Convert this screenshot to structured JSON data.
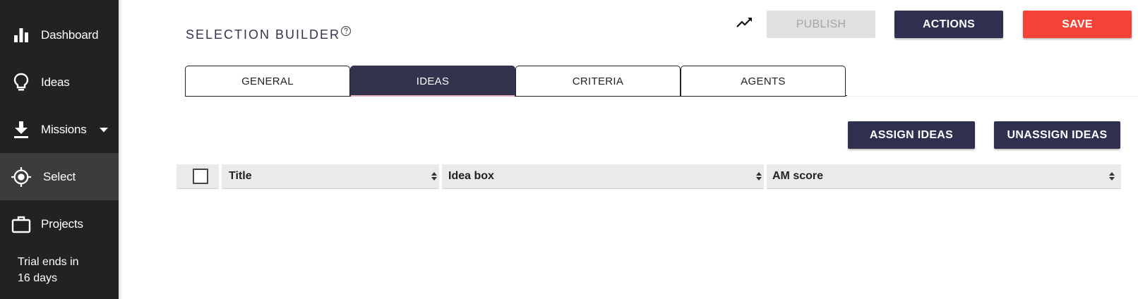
{
  "sidebar": {
    "items": [
      {
        "label": "Dashboard",
        "icon": "bar-chart-icon"
      },
      {
        "label": "Ideas",
        "icon": "lightbulb-icon"
      },
      {
        "label": "Missions",
        "icon": "download-icon"
      },
      {
        "label": "Select",
        "icon": "target-icon"
      },
      {
        "label": "Projects",
        "icon": "briefcase-icon"
      }
    ],
    "active": "Select",
    "trial_line1": "Trial ends in",
    "trial_line2": "16 days"
  },
  "header": {
    "title": "SELECTION BUILDER",
    "publish_label": "PUBLISH",
    "actions_label": "ACTIONS",
    "save_label": "SAVE"
  },
  "tabs": [
    {
      "label": "GENERAL"
    },
    {
      "label": "IDEAS"
    },
    {
      "label": "CRITERIA"
    },
    {
      "label": "AGENTS"
    }
  ],
  "active_tab": "IDEAS",
  "toolbar": {
    "assign_label": "ASSIGN IDEAS",
    "unassign_label": "UNASSIGN IDEAS"
  },
  "table": {
    "columns": [
      "Title",
      "Idea box",
      "AM score"
    ],
    "rows": []
  },
  "colors": {
    "sidebar_bg": "#222222",
    "primary": "#2f2f4f",
    "save": "#f44336",
    "disabled": "#e0e0e0"
  }
}
